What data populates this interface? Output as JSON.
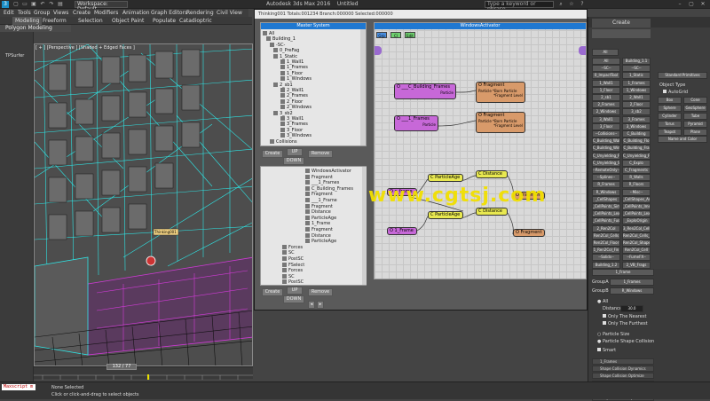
{
  "window": {
    "title": "Autodesk 3ds Max 2016",
    "doc": "Untitled",
    "workspace": "Workspace: Default",
    "search_placeholder": "Type a keyword or phrase"
  },
  "menus": [
    "Edit",
    "Tools",
    "Group",
    "Views",
    "Create",
    "Modifiers",
    "Animation",
    "Graph Editors",
    "Rendering",
    "Civil View"
  ],
  "ribbon_tabs": [
    "Modeling",
    "Freeform",
    "Selection",
    "Object Paint",
    "Populate",
    "Catadioptric"
  ],
  "ribbon_sub": "Polygon Modeling",
  "left_strip": {
    "tpmenu": "TPSurfer",
    "selection": "Selected"
  },
  "viewport": {
    "label": "[ + ] [Perspective ] [Shaded + Edged Faces ]",
    "helper_label": "Thinking001",
    "frame": "132 / 77"
  },
  "statusbar": {
    "maxscript": "Maxscript m",
    "status_line": "None Selected",
    "prompt": "Click or click-and-drag to select objects"
  },
  "pview": {
    "title": "Thinking001  Totals:001234  Branch:000000  Selected:000000",
    "master_system": "Master System",
    "windows_activator": "WindowsActivator",
    "tree": [
      "All",
      "Building_1",
      "-SC-",
      "0_PreFag",
      "1_Static",
      "1_Wall1",
      "1_Frames",
      "1_Floor",
      "1_Windows",
      "2_sb1",
      "2_Wall1",
      "2_Frames",
      "2_Floor",
      "2_Windows",
      "3_sb2",
      "3_Wall1",
      "3_Frames",
      "3_Floor",
      "3_Windows",
      "Collisions"
    ],
    "buttons": {
      "create": "Create",
      "up": "UP",
      "down": "DOWN",
      "remove": "Remove"
    },
    "ops": [
      "WindowsActivator",
      "Fragment",
      "___1_Frames",
      "C_Building_Frames",
      "Fragment",
      "___1_Frame",
      "Fragment",
      "Distance",
      "ParticleAge",
      "1_Frame",
      "Fragment",
      "Distance",
      "ParticleAge",
      "Forces",
      "SC",
      "PostSC",
      "FSelect",
      "Forces",
      "SC",
      "PostSC"
    ],
    "graph_tabs": [
      "Grp",
      "Cl",
      "Edit"
    ],
    "nodes": {
      "n1": "O ___C_Building_Frames",
      "n1sub": "Particle",
      "n2": "O Fragment",
      "n2sub1": "Particle  *Born Particle",
      "n2sub2": "*Fragment Level",
      "n3": "O ___1_Frames",
      "n3sub": "Particle",
      "n4": "O Fragment",
      "n4sub1": "Particle  *Born Particle",
      "n4sub2": "*Fragment Level",
      "n5": "O c_frame",
      "n6": "C ParticleAge",
      "n7": "C Distance",
      "n8": "O Fragment",
      "n9": "O 1_Frame",
      "n10": "C ParticleAge",
      "n11": "C Distance",
      "n12": "O Fragment"
    },
    "watermark": "www.cgtsj.com"
  },
  "cmd_panel": {
    "header": "Create",
    "section_label": "Object Type",
    "autogrid": "AutoGrid",
    "primitives_title": "Standard Primitives",
    "primitives": [
      "Box",
      "Cone",
      "Sphere",
      "GeoSphere",
      "Cylinder",
      "Tube",
      "Torus",
      "Pyramid",
      "Teapot",
      "Plane"
    ],
    "name_color": "Name and Color",
    "all_btn": "All",
    "list": [
      [
        "All",
        "Building_1.1"
      ],
      [
        "--SC--",
        "--SC--"
      ],
      [
        "0_ImpactTool",
        "1_Static"
      ],
      [
        "1_Wall1",
        "1_Frames"
      ],
      [
        "1_Floor",
        "1_Windows"
      ],
      [
        "2_sb1",
        "2_Wall1"
      ],
      [
        "2_Frames",
        "2_Floor"
      ],
      [
        "2_Windows",
        "3_sb2"
      ],
      [
        "3_Wall1",
        "3_Frames"
      ],
      [
        "3_Floor",
        "3_Windows"
      ],
      [
        "--Collisions--",
        "C_Building"
      ],
      [
        "C_Building_Wall",
        "C_Building_Flo"
      ],
      [
        "C_Building_Win",
        "C_Building_Fra"
      ],
      [
        "C_Unyielding_Fl",
        "C_Unyielding_Fr"
      ],
      [
        "C_Unyielding_Sk",
        "C_Explo"
      ],
      [
        "--RemoteOnly--",
        "C_Fragments"
      ],
      [
        "--Splines--",
        "R_Walls"
      ],
      [
        "R_Frames",
        "R_Floors"
      ],
      [
        "R_Windows",
        "--Misc--"
      ],
      [
        "_CellShapes",
        "_CellShapes_Ame"
      ],
      [
        "_CellPoints_Sim",
        "_CellPoints_Ime"
      ],
      [
        "_CellPoints_Lex",
        "_CellPoints_Lex"
      ],
      [
        "_CellPoints_Fus",
        "_ExploOrigin"
      ],
      [
        "2_Ren2Col",
        "3_Ren2Col_Cells"
      ],
      [
        "Ren2Col_Cells",
        "Ren2Col_Cells_2"
      ],
      [
        "Ren2Col_Floor",
        "Ren2Col_Shape"
      ],
      [
        "1_Ren2Col_Fin",
        "Ren2Col_Cell"
      ],
      [
        "--Solids--",
        "--FumeFX--"
      ],
      [
        "Building_1.2",
        "2_VB_Frags"
      ]
    ],
    "group_name": "1_Frame",
    "groupA_label": "GroupA",
    "groupA_val": "1_Frames",
    "groupB_label": "GroupB",
    "groupB_val": "R_Windows",
    "all_radio": "All",
    "distance_label": "Distance",
    "distance_val": "30.0",
    "only_nearest": "Only The Nearest",
    "only_furthest": "Only The Furthest",
    "particle_size": "Particle Size",
    "particle_shape": "Particle Shape Collision",
    "smart": "Smart",
    "rollouts": [
      "1_Frames",
      "Shape Collision Dynamics",
      "Shape Collision Optimize",
      "R_Windows",
      "Shape Collision Dynamics",
      "Shape Collision Optimize"
    ]
  },
  "colors": {
    "accent": "#1f78d1",
    "wire_cyan": "#2ee6e6",
    "wire_magenta": "#d23ad8",
    "watermark": "#f2e000"
  }
}
